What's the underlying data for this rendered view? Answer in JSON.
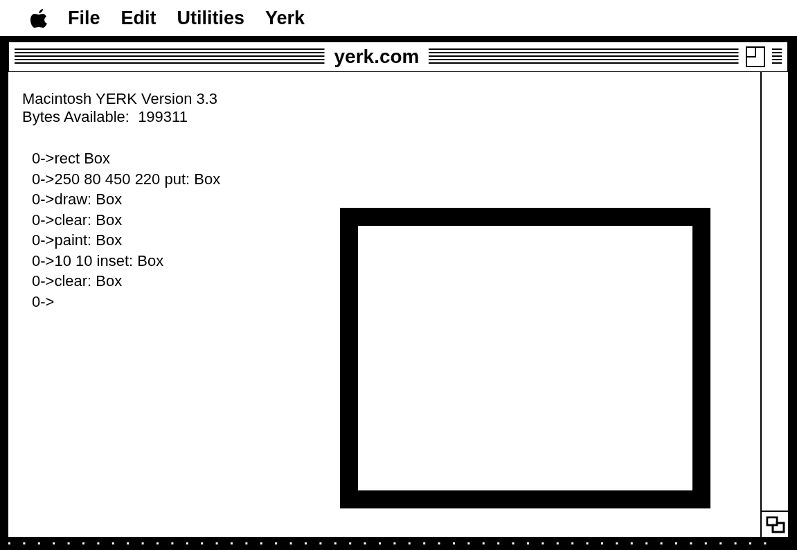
{
  "menu_bar": {
    "items": [
      "File",
      "Edit",
      "Utilities",
      "Yerk"
    ]
  },
  "window": {
    "title": "yerk.com"
  },
  "console": {
    "header": [
      "Macintosh YERK Version 3.3",
      "Bytes Available:  199311"
    ],
    "lines": [
      "0->rect Box",
      "0->250 80 450 220 put: Box",
      "0->draw: Box",
      "0->clear: Box",
      "0->paint: Box",
      "0->10 10 inset: Box",
      "0->clear: Box",
      "0->"
    ]
  }
}
